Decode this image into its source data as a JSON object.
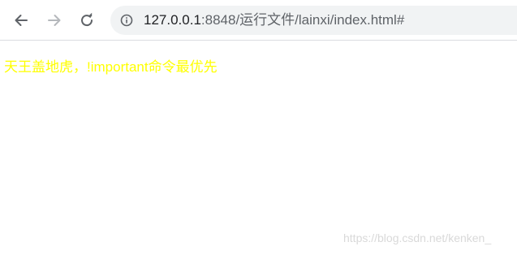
{
  "toolbar": {
    "back_icon": "arrow-left-icon",
    "forward_icon": "arrow-right-icon",
    "reload_icon": "reload-icon",
    "site_info_icon": "info-circle-icon",
    "url_host": "127.0.0.1",
    "url_rest": ":8848/运行文件/lainxi/index.html#"
  },
  "page": {
    "line_text": "天王盖地虎，!important命令最优先",
    "line_color": "#ffff00"
  },
  "watermark": {
    "text": "https://blog.csdn.net/kenken_"
  }
}
